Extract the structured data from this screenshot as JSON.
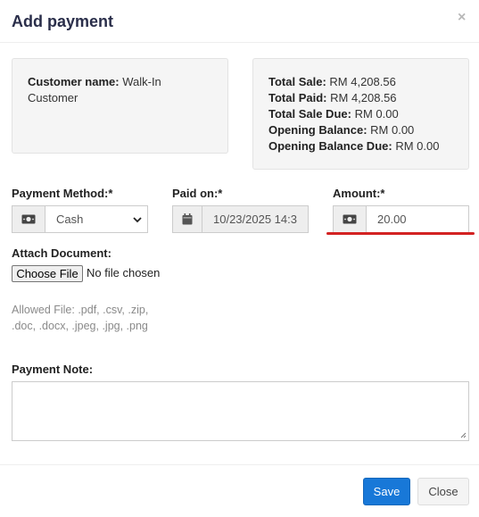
{
  "modal": {
    "title": "Add payment",
    "close_glyph": "×"
  },
  "customer": {
    "label": "Customer name:",
    "value": "Walk-In Customer"
  },
  "summary": [
    {
      "label": "Total Sale:",
      "value": "RM 4,208.56"
    },
    {
      "label": "Total Paid:",
      "value": "RM 4,208.56"
    },
    {
      "label": "Total Sale Due:",
      "value": "RM 0.00"
    },
    {
      "label": "Opening Balance:",
      "value": "RM 0.00"
    },
    {
      "label": "Opening Balance Due:",
      "value": "RM 0.00"
    }
  ],
  "form": {
    "payment_method": {
      "label": "Payment Method:*",
      "value": "Cash",
      "icon": "money-icon"
    },
    "paid_on": {
      "label": "Paid on:*",
      "value": "10/23/2025 14:3",
      "icon": "calendar-icon"
    },
    "amount": {
      "label": "Amount:*",
      "value": "20.00",
      "icon": "money-icon"
    },
    "attach": {
      "label": "Attach Document:",
      "button": "Choose File",
      "status": "No file chosen"
    },
    "allowed_files": "Allowed File: .pdf, .csv, .zip, .doc, .docx, .jpeg, .jpg, .png",
    "note": {
      "label": "Payment Note:",
      "value": ""
    }
  },
  "footer": {
    "save_label": "Save",
    "close_label": "Close"
  },
  "colors": {
    "primary": "#1878d8",
    "highlight_underline": "#d32222",
    "title": "#2a2e4a"
  }
}
